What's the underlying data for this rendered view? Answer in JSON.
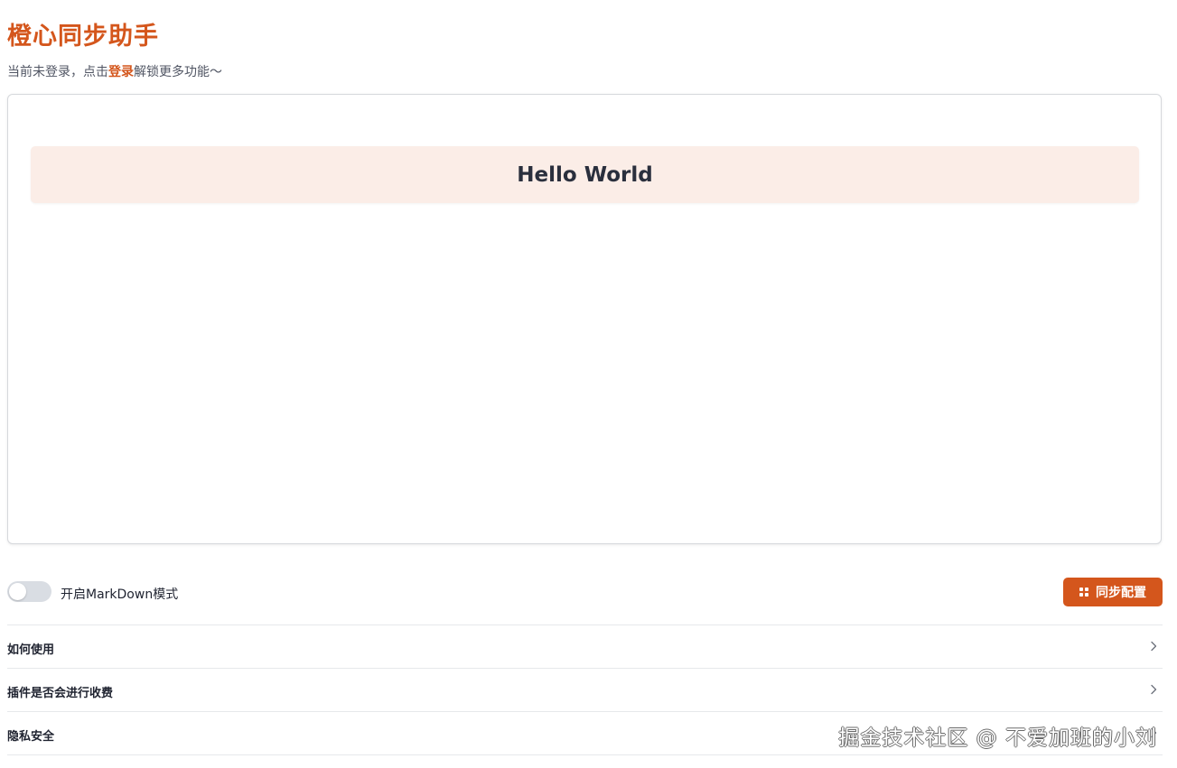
{
  "app": {
    "title": "橙心同步助手"
  },
  "login_notice": {
    "prefix": "当前未登录，点击",
    "link_label": "登录",
    "suffix": "解锁更多功能～"
  },
  "editor": {
    "heading_text": "Hello World"
  },
  "markdown_toggle": {
    "label": "开启MarkDown模式",
    "enabled": false
  },
  "sync_button": {
    "label": "同步配置",
    "icon": "grid-icon"
  },
  "faq": {
    "items": [
      {
        "label": "如何使用",
        "icon": "chevron-right-icon"
      },
      {
        "label": "插件是否会进行收费",
        "icon": "chevron-right-icon"
      },
      {
        "label": "隐私安全",
        "icon": "chevron-right-icon"
      }
    ]
  },
  "watermark": {
    "text": "掘金技术社区 @ 不爱加班的小刘"
  },
  "colors": {
    "accent": "#d4561c",
    "heading_bg": "#fbede7",
    "switch_off": "#d9dde3",
    "divider": "#e6e8eb"
  }
}
